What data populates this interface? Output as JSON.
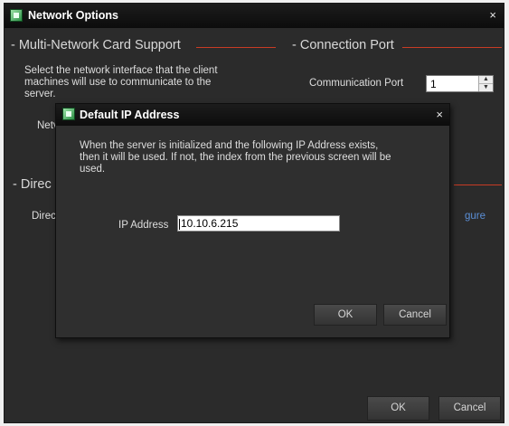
{
  "main_window": {
    "title": "Network Options",
    "close_glyph": "×",
    "icon": "app-icon",
    "multi_nic": {
      "header": "- Multi-Network Card Support",
      "description_lines": [
        "Select the network interface that the client",
        "machines will use to communicate to the",
        "server."
      ],
      "network_label_partial": "Netv"
    },
    "connection_port": {
      "header": "- Connection Port",
      "comm_port_label": "Communication Port",
      "comm_port_value": "1",
      "spin_up": "▲",
      "spin_down": "▼"
    },
    "directory": {
      "header_partial": "- Direc",
      "label_partial": "Direc",
      "link_partial": "gure"
    },
    "ok_label": "OK",
    "cancel_label": "Cancel"
  },
  "dialog": {
    "title": "Default IP Address",
    "close_glyph": "×",
    "description_lines": [
      "When the server is initialized and the following IP Address exists,",
      "then it will be used.  If not, the index from the previous screen will be",
      "used."
    ],
    "ip_label": "IP Address",
    "ip_value": "10.10.6.215",
    "ok_label": "OK",
    "cancel_label": "Cancel"
  },
  "colors": {
    "window_bg": "#2b2b2b",
    "titlebar": "#0c0c0c",
    "accent_rule": "#c83b24",
    "text": "#dedede",
    "link": "#5b8fd6"
  }
}
